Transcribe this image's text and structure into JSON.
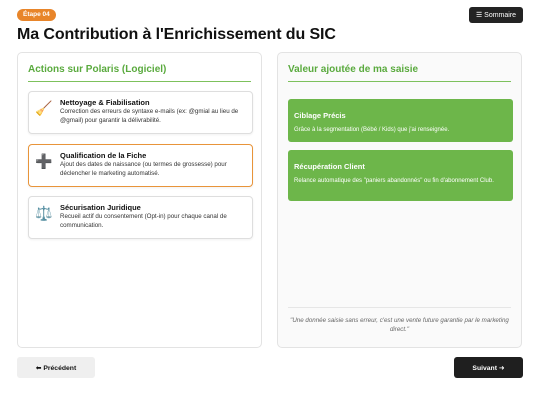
{
  "header": {
    "step_badge": "Étape 04",
    "summary_label": "☰ Sommaire",
    "title": "Ma Contribution à l'Enrichissement du SIC"
  },
  "left_panel": {
    "heading": "Actions sur Polaris (Logiciel)",
    "actions": [
      {
        "icon": "broom-icon",
        "glyph": "🧹",
        "title": "Nettoyage & Fiabilisation",
        "desc": "Correction des erreurs de syntaxe e-mails (ex: @gmial au lieu de @gmail) pour garantir la délivrabilité."
      },
      {
        "icon": "plus-icon",
        "glyph": "➕",
        "title": "Qualification de la Fiche",
        "desc": "Ajout des dates de naissance (ou termes de grossesse) pour déclencher le marketing automatisé."
      },
      {
        "icon": "scales-icon",
        "glyph": "⚖️",
        "title": "Sécurisation Juridique",
        "desc": "Recueil actif du consentement (Opt-in) pour chaque canal de communication."
      }
    ]
  },
  "right_panel": {
    "heading": "Valeur ajoutée de ma saisie",
    "values": [
      {
        "title": "Ciblage Précis",
        "desc": "Grâce à la segmentation (Bébé / Kids) que j'ai renseignée."
      },
      {
        "title": "Récupération Client",
        "desc": "Relance automatique des \"paniers abandonnés\" ou fin d'abonnement Club."
      }
    ],
    "quote": "\"Une donnée saisie sans erreur, c'est une vente future garantie par le marketing direct.\""
  },
  "footer": {
    "prev_label": "⬅ Précédent",
    "next_label": "Suivant ➜"
  },
  "colors": {
    "accent_orange": "#e8852a",
    "accent_green": "#6db64a",
    "heading_green": "#5aaa3e",
    "dark_button": "#1f1f1f"
  }
}
